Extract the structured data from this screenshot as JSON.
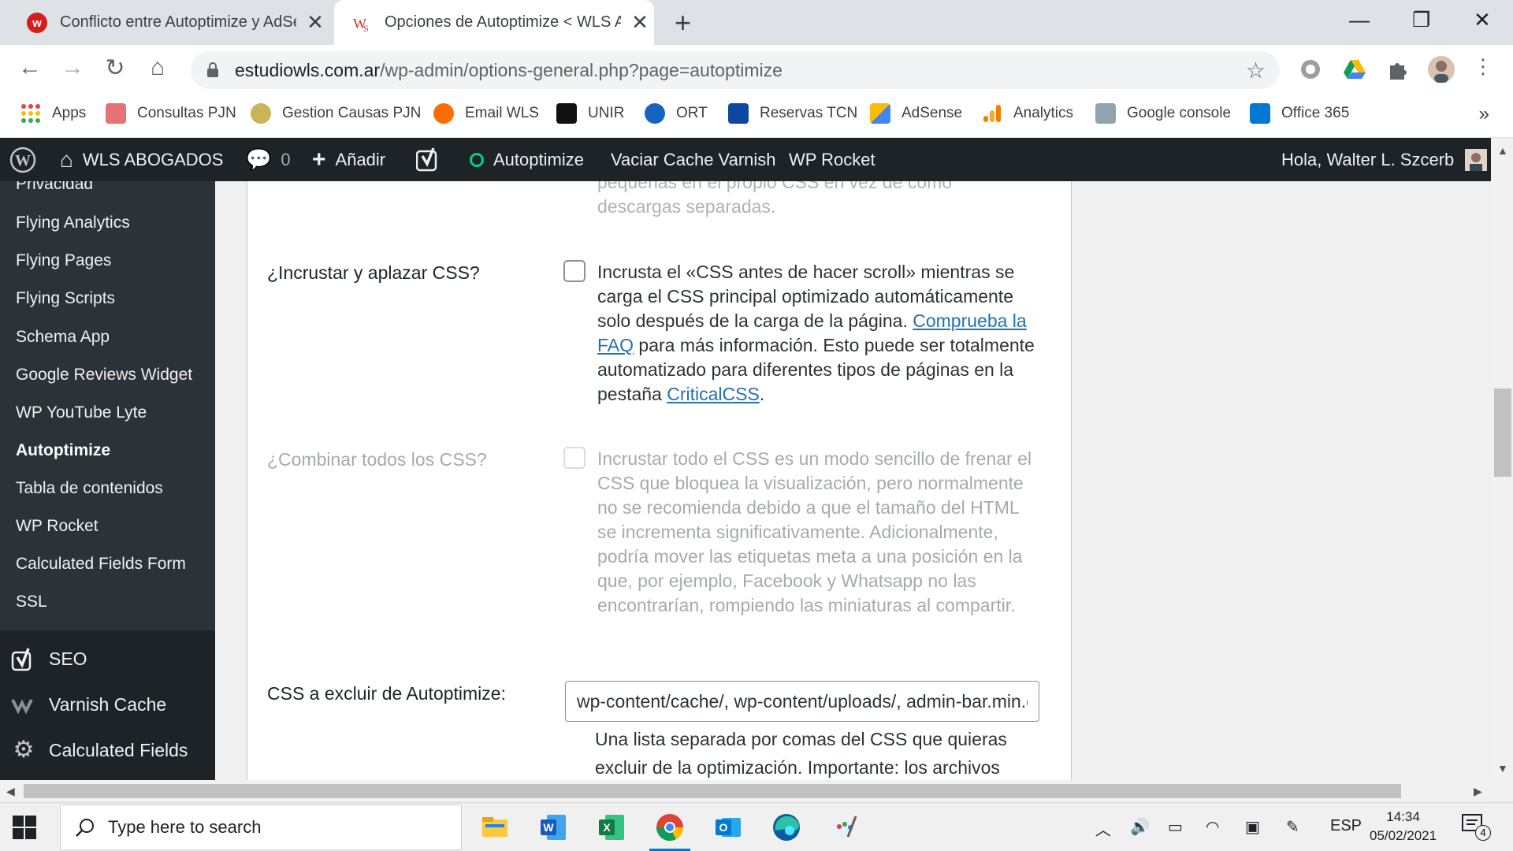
{
  "browser": {
    "tabs": [
      {
        "title": "Conflicto entre Autoptimize y AdSense",
        "active": false
      },
      {
        "title": "Opciones de Autoptimize < WLS ABOGADOS",
        "active": true
      }
    ],
    "url_host": "estudiowls.com.ar",
    "url_path": "/wp-admin/options-general.php?page=autoptimize",
    "bookmarks": [
      "Apps",
      "Consultas PJN",
      "Gestion Causas PJN",
      "Email WLS",
      "UNIR",
      "ORT",
      "Reservas TCN",
      "AdSense",
      "Analytics",
      "Google console",
      "Office 365"
    ],
    "more": "»"
  },
  "adminbar": {
    "site": "WLS ABOGADOS",
    "comments": "0",
    "add": "Añadir",
    "autoptimize": "Autoptimize",
    "varnish": "Vaciar Cache Varnish",
    "rocket": "WP Rocket",
    "greeting": "Hola, Walter L. Szcerb"
  },
  "sidebar": {
    "submenu": [
      "Privacidad",
      "Flying Analytics",
      "Flying Pages",
      "Flying Scripts",
      "Schema App",
      "Google Reviews Widget",
      "WP YouTube Lyte",
      "Autoptimize",
      "Tabla de contenidos",
      "WP Rocket",
      "Calculated Fields Form",
      "SSL"
    ],
    "current": "Autoptimize",
    "menu": [
      "SEO",
      "Varnish Cache",
      "Calculated Fields"
    ]
  },
  "settings": {
    "top_fragment_1": "pequeñas en el propio CSS en vez de como",
    "top_fragment_2": "descargas separadas.",
    "inline_defer": {
      "label": "¿Incrustar y aplazar CSS?",
      "desc_1": "Incrusta el «CSS antes de hacer scroll» mientras se carga el CSS principal optimizado automáticamente solo después de la carga de la página. ",
      "link_1": "Comprueba la FAQ",
      "desc_2": " para más información. Esto puede ser totalmente automatizado para diferentes tipos de páginas en la pestaña ",
      "link_2": "CriticalCSS",
      "desc_3": "."
    },
    "inline_all": {
      "label": "¿Combinar todos los CSS?",
      "desc": "Incrustar todo el CSS es un modo sencillo de frenar el CSS que bloquea la visualización, pero normalmente no se recomienda debido a que el tamaño del HTML se incrementa significativamente. Adicionalmente, podría mover las etiquetas meta a una posición en la que, por ejemplo, Facebook y Whatsapp no las encontrarían, rompiendo las miniaturas al compartir."
    },
    "exclude": {
      "label": "CSS a excluir de Autoptimize:",
      "value": "wp-content/cache/, wp-content/uploads/, admin-bar.min.css",
      "help": "Una lista separada por comas del CSS que quieras excluir de la optimización. Importante: los archivos excluidos no"
    }
  },
  "taskbar": {
    "search_placeholder": "Type here to search",
    "lang": "ESP",
    "time": "14:34",
    "date": "05/02/2021",
    "notifications": "4"
  },
  "colors": {
    "adminbar": "#1d2327",
    "sidebar": "#2c3338",
    "link": "#2271b1"
  }
}
